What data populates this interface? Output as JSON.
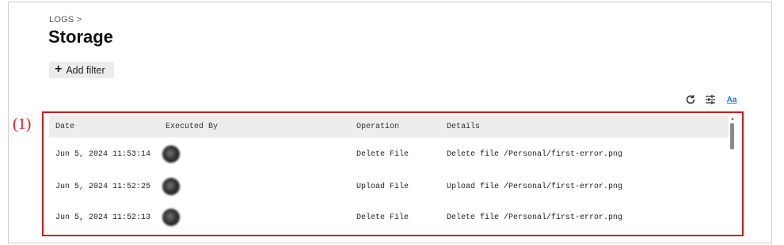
{
  "header": {
    "breadcrumb": "LOGS >",
    "title": "Storage"
  },
  "filter": {
    "plus_symbol": "+",
    "add_label": "Add filter"
  },
  "toolbar": {
    "icons": [
      "refresh-icon",
      "column-settings-icon",
      "font-size-icon"
    ],
    "font_icon_label": "Aa"
  },
  "annotation": {
    "label": "(1)",
    "color": "#d11a1a"
  },
  "table": {
    "columns": [
      "Date",
      "Executed By",
      "Operation",
      "Details"
    ],
    "rows": [
      {
        "date": "Jun 5, 2024 11:53:14",
        "executed_by": "",
        "operation": "Delete File",
        "details": "Delete file /Personal/first-error.png"
      },
      {
        "date": "Jun 5, 2024 11:52:25",
        "executed_by": "",
        "operation": "Upload File",
        "details": "Upload file /Personal/first-error.png"
      },
      {
        "date": "Jun 5, 2024 11:52:13",
        "executed_by": "",
        "operation": "Delete File",
        "details": "Delete file /Personal/first-error.png"
      }
    ]
  },
  "colors": {
    "header_bg": "#ededed",
    "filter_bg": "#ececec",
    "accent": "#2d6fc4"
  }
}
